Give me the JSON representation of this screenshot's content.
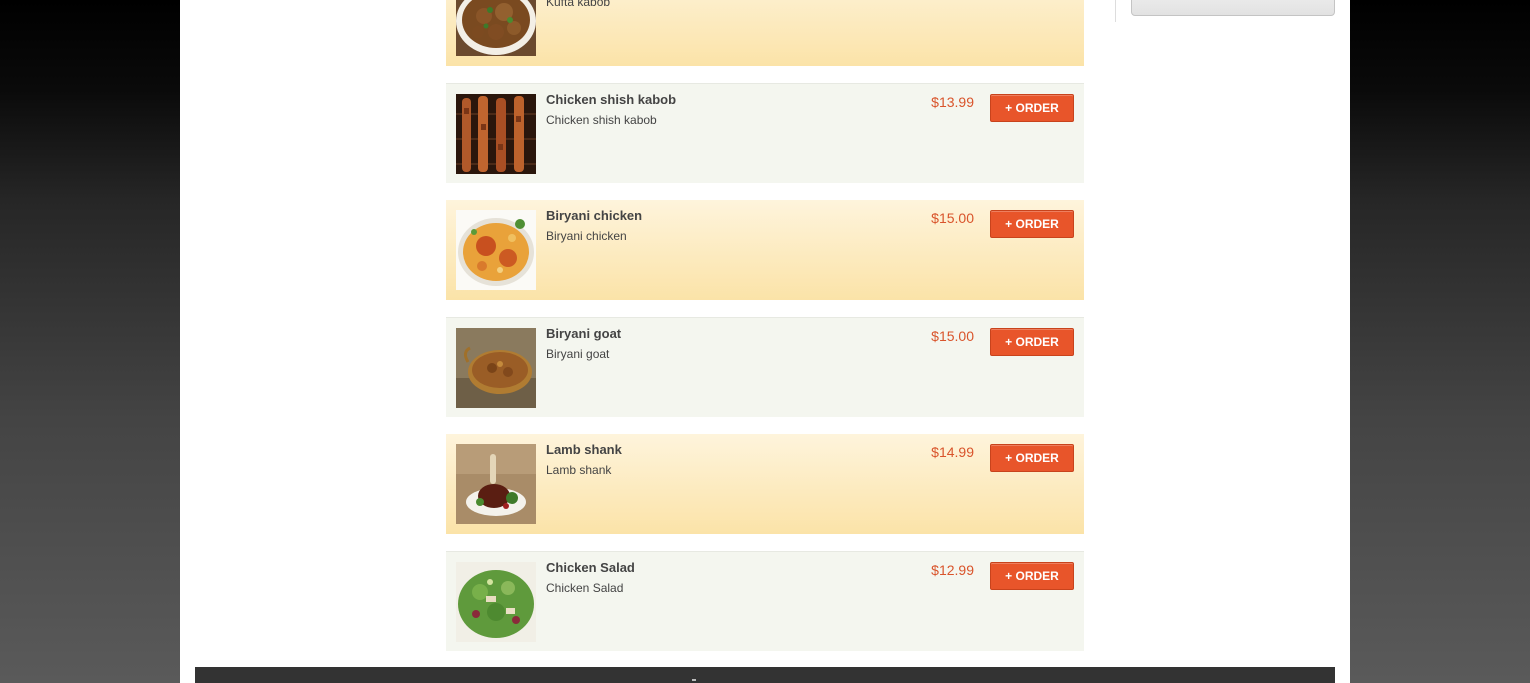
{
  "menu": {
    "order_label": "+ ORDER",
    "items": [
      {
        "name": "",
        "description": "Kufta kabob",
        "price": ""
      },
      {
        "name": "Chicken shish kabob",
        "description": "Chicken shish kabob",
        "price": "$13.99"
      },
      {
        "name": "Biryani chicken",
        "description": "Biryani chicken",
        "price": "$15.00"
      },
      {
        "name": "Biryani goat",
        "description": "Biryani goat",
        "price": "$15.00"
      },
      {
        "name": "Lamb shank",
        "description": "Lamb shank",
        "price": "$14.99"
      },
      {
        "name": "Chicken Salad",
        "description": "Chicken Salad",
        "price": "$12.99"
      }
    ]
  },
  "colors": {
    "accent": "#e8552a",
    "price": "#d9542b",
    "featured_row": "#fbe3a8",
    "plain_row": "#f4f6ef"
  }
}
